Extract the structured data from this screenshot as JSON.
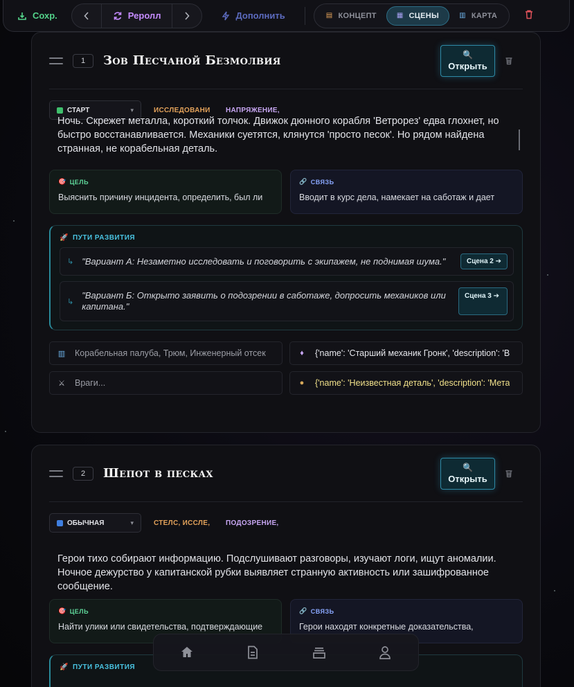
{
  "toolbar": {
    "save_label": "Сохр.",
    "reroll_label": "Реролл",
    "fill_label": "Дополнить",
    "tabs": [
      {
        "label": "КОНЦЕПТ",
        "active": false
      },
      {
        "label": "СЦЕНЫ",
        "active": true
      },
      {
        "label": "КАРТА",
        "active": false
      }
    ]
  },
  "scenes": [
    {
      "number": "1",
      "title": "Зов Песчаной Безмолвия",
      "open_label": "Открыть",
      "type": "СТАРТ",
      "type_color": "#3fbf6c",
      "tag1": "ИССЛЕДОВАНИ",
      "tag2": "НАПРЯЖЕНИЕ, І",
      "description": "Ночь. Скрежет металла, короткий толчок. Движок дюнного корабля 'Ветрорез' едва глохнет, но быстро восстанавливается. Механики суетятся, клянутся 'просто песок'. Но рядом найдена странная, не корабельная деталь.",
      "goal_label": "ЦЕЛЬ",
      "goal_text": "Выяснить причину инцидента, определить, был ли",
      "link_label": "СВЯЗЬ",
      "link_text": "Вводит в курс дела, намекает на саботаж и дает",
      "paths_label": "ПУТИ РАЗВИТИЯ",
      "paths": [
        {
          "text": "\"Вариант А: Незаметно исследовать и поговорить с экипажем, не поднимая шума.\"",
          "goto": "Сцена 2 ➔"
        },
        {
          "text": "\"Вариант Б: Открыто заявить о подозрении в саботаже, допросить механиков или капитана.\"",
          "goto": "Сцена 3 ➔"
        }
      ],
      "locations": "Корабельная палуба, Трюм, Инженерный отсек",
      "npcs": "{'name': 'Старший механик Гронк', 'description': 'В",
      "enemies": "Враги...",
      "items": "{'name': 'Неизвестная деталь', 'description': 'Мета"
    },
    {
      "number": "2",
      "title": "Шепот в песках",
      "open_label": "Открыть",
      "type": "ОБЫЧНАЯ",
      "type_color": "#3f7fe0",
      "tag1": "СТЕЛС, ИССЛЕ,",
      "tag2": "ПОДОЗРЕНИЕ, І",
      "description": "Герои тихо собирают информацию. Подслушивают разговоры, изучают логи, ищут аномалии. Ночное дежурство у капитанской рубки выявляет странную активность или зашифрованное сообщение.",
      "goal_label": "ЦЕЛЬ",
      "goal_text": "Найти улики или свидетельства, подтверждающие",
      "link_label": "СВЯЗЬ",
      "link_text": "Герои находят конкретные доказательства,",
      "paths_label": "ПУТИ РАЗВИТИЯ"
    }
  ]
}
